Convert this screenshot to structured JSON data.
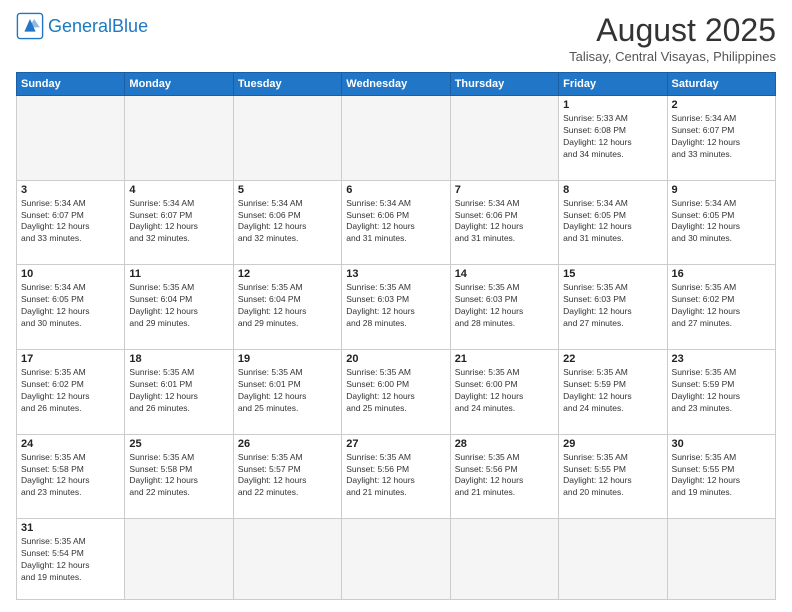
{
  "header": {
    "logo_general": "General",
    "logo_blue": "Blue",
    "month_title": "August 2025",
    "location": "Talisay, Central Visayas, Philippines"
  },
  "weekdays": [
    "Sunday",
    "Monday",
    "Tuesday",
    "Wednesday",
    "Thursday",
    "Friday",
    "Saturday"
  ],
  "weeks": [
    [
      {
        "day": "",
        "info": ""
      },
      {
        "day": "",
        "info": ""
      },
      {
        "day": "",
        "info": ""
      },
      {
        "day": "",
        "info": ""
      },
      {
        "day": "",
        "info": ""
      },
      {
        "day": "1",
        "info": "Sunrise: 5:33 AM\nSunset: 6:08 PM\nDaylight: 12 hours\nand 34 minutes."
      },
      {
        "day": "2",
        "info": "Sunrise: 5:34 AM\nSunset: 6:07 PM\nDaylight: 12 hours\nand 33 minutes."
      }
    ],
    [
      {
        "day": "3",
        "info": "Sunrise: 5:34 AM\nSunset: 6:07 PM\nDaylight: 12 hours\nand 33 minutes."
      },
      {
        "day": "4",
        "info": "Sunrise: 5:34 AM\nSunset: 6:07 PM\nDaylight: 12 hours\nand 32 minutes."
      },
      {
        "day": "5",
        "info": "Sunrise: 5:34 AM\nSunset: 6:06 PM\nDaylight: 12 hours\nand 32 minutes."
      },
      {
        "day": "6",
        "info": "Sunrise: 5:34 AM\nSunset: 6:06 PM\nDaylight: 12 hours\nand 31 minutes."
      },
      {
        "day": "7",
        "info": "Sunrise: 5:34 AM\nSunset: 6:06 PM\nDaylight: 12 hours\nand 31 minutes."
      },
      {
        "day": "8",
        "info": "Sunrise: 5:34 AM\nSunset: 6:05 PM\nDaylight: 12 hours\nand 31 minutes."
      },
      {
        "day": "9",
        "info": "Sunrise: 5:34 AM\nSunset: 6:05 PM\nDaylight: 12 hours\nand 30 minutes."
      }
    ],
    [
      {
        "day": "10",
        "info": "Sunrise: 5:34 AM\nSunset: 6:05 PM\nDaylight: 12 hours\nand 30 minutes."
      },
      {
        "day": "11",
        "info": "Sunrise: 5:35 AM\nSunset: 6:04 PM\nDaylight: 12 hours\nand 29 minutes."
      },
      {
        "day": "12",
        "info": "Sunrise: 5:35 AM\nSunset: 6:04 PM\nDaylight: 12 hours\nand 29 minutes."
      },
      {
        "day": "13",
        "info": "Sunrise: 5:35 AM\nSunset: 6:03 PM\nDaylight: 12 hours\nand 28 minutes."
      },
      {
        "day": "14",
        "info": "Sunrise: 5:35 AM\nSunset: 6:03 PM\nDaylight: 12 hours\nand 28 minutes."
      },
      {
        "day": "15",
        "info": "Sunrise: 5:35 AM\nSunset: 6:03 PM\nDaylight: 12 hours\nand 27 minutes."
      },
      {
        "day": "16",
        "info": "Sunrise: 5:35 AM\nSunset: 6:02 PM\nDaylight: 12 hours\nand 27 minutes."
      }
    ],
    [
      {
        "day": "17",
        "info": "Sunrise: 5:35 AM\nSunset: 6:02 PM\nDaylight: 12 hours\nand 26 minutes."
      },
      {
        "day": "18",
        "info": "Sunrise: 5:35 AM\nSunset: 6:01 PM\nDaylight: 12 hours\nand 26 minutes."
      },
      {
        "day": "19",
        "info": "Sunrise: 5:35 AM\nSunset: 6:01 PM\nDaylight: 12 hours\nand 25 minutes."
      },
      {
        "day": "20",
        "info": "Sunrise: 5:35 AM\nSunset: 6:00 PM\nDaylight: 12 hours\nand 25 minutes."
      },
      {
        "day": "21",
        "info": "Sunrise: 5:35 AM\nSunset: 6:00 PM\nDaylight: 12 hours\nand 24 minutes."
      },
      {
        "day": "22",
        "info": "Sunrise: 5:35 AM\nSunset: 5:59 PM\nDaylight: 12 hours\nand 24 minutes."
      },
      {
        "day": "23",
        "info": "Sunrise: 5:35 AM\nSunset: 5:59 PM\nDaylight: 12 hours\nand 23 minutes."
      }
    ],
    [
      {
        "day": "24",
        "info": "Sunrise: 5:35 AM\nSunset: 5:58 PM\nDaylight: 12 hours\nand 23 minutes."
      },
      {
        "day": "25",
        "info": "Sunrise: 5:35 AM\nSunset: 5:58 PM\nDaylight: 12 hours\nand 22 minutes."
      },
      {
        "day": "26",
        "info": "Sunrise: 5:35 AM\nSunset: 5:57 PM\nDaylight: 12 hours\nand 22 minutes."
      },
      {
        "day": "27",
        "info": "Sunrise: 5:35 AM\nSunset: 5:56 PM\nDaylight: 12 hours\nand 21 minutes."
      },
      {
        "day": "28",
        "info": "Sunrise: 5:35 AM\nSunset: 5:56 PM\nDaylight: 12 hours\nand 21 minutes."
      },
      {
        "day": "29",
        "info": "Sunrise: 5:35 AM\nSunset: 5:55 PM\nDaylight: 12 hours\nand 20 minutes."
      },
      {
        "day": "30",
        "info": "Sunrise: 5:35 AM\nSunset: 5:55 PM\nDaylight: 12 hours\nand 19 minutes."
      }
    ],
    [
      {
        "day": "31",
        "info": "Sunrise: 5:35 AM\nSunset: 5:54 PM\nDaylight: 12 hours\nand 19 minutes."
      },
      {
        "day": "",
        "info": ""
      },
      {
        "day": "",
        "info": ""
      },
      {
        "day": "",
        "info": ""
      },
      {
        "day": "",
        "info": ""
      },
      {
        "day": "",
        "info": ""
      },
      {
        "day": "",
        "info": ""
      }
    ]
  ]
}
